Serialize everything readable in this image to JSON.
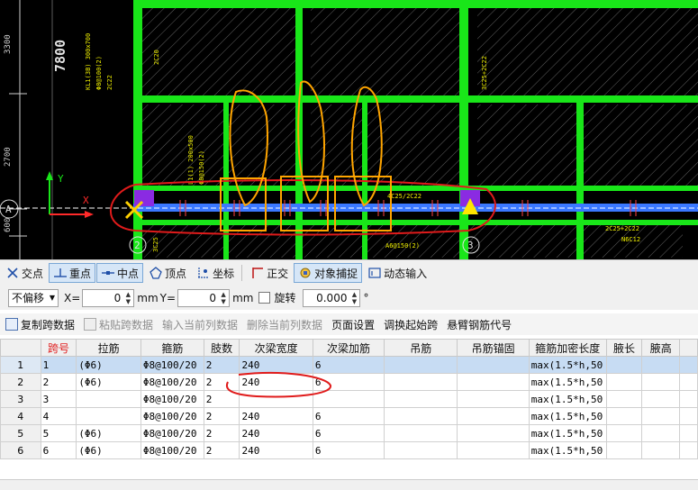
{
  "cad": {
    "dims": [
      "3300",
      "2700",
      "600"
    ],
    "big_label": "7800",
    "axis_letter": "A",
    "axis_numbers": [
      "2",
      "3"
    ],
    "y_axis": "Y",
    "x_axis": "X",
    "beam_texts": [
      "KL1(3B) 300x700",
      "Φ8@100(2)",
      "2C22",
      "3C25+2C22",
      "L1(1) 200x500",
      "Φ8@150(2)",
      "4C25/2C22",
      "A6@150(2)",
      "2C25+2C22",
      "N6C12",
      "2C20",
      "3C25"
    ]
  },
  "snapbar": {
    "items": [
      {
        "label": "交点",
        "icon": "cross-snap-icon",
        "active": false
      },
      {
        "label": "重点",
        "icon": "coincide-snap-icon",
        "active": true
      },
      {
        "label": "中点",
        "icon": "midpoint-snap-icon",
        "active": true
      },
      {
        "label": "顶点",
        "icon": "vertex-snap-icon",
        "active": false
      },
      {
        "label": "坐标",
        "icon": "coordinate-snap-icon",
        "active": false
      },
      {
        "label": "正交",
        "icon": "orthogonal-icon",
        "active": false
      },
      {
        "label": "对象捕捉",
        "icon": "object-snap-icon",
        "active": true
      },
      {
        "label": "动态输入",
        "icon": "dynamic-input-icon",
        "active": false
      }
    ]
  },
  "offsetbar": {
    "mode": "不偏移",
    "x_label": "X=",
    "x_value": "0",
    "x_unit": "mm",
    "y_label": "Y=",
    "y_value": "0",
    "y_unit": "mm",
    "rotate_label": "旋转",
    "rotate_value": "0.000",
    "degree": "°"
  },
  "gridtools": {
    "items": [
      {
        "label": "复制跨数据",
        "disabled": false
      },
      {
        "label": "粘贴跨数据",
        "disabled": true
      },
      {
        "label": "输入当前列数据",
        "disabled": true
      },
      {
        "label": "删除当前列数据",
        "disabled": true
      },
      {
        "label": "页面设置",
        "disabled": false
      },
      {
        "label": "调换起始跨",
        "disabled": false
      },
      {
        "label": "悬臂钢筋代号",
        "disabled": false
      }
    ]
  },
  "table": {
    "headers": {
      "span": "跨号",
      "tie": "拉筋",
      "stirrup": "箍筋",
      "legs": "肢数",
      "sec_width": "次梁宽度",
      "sec_add": "次梁加筋",
      "hanger": "吊筋",
      "hanger_anchor": "吊筋锚固",
      "dense_len": "箍筋加密长度",
      "haunch_len": "腋长",
      "haunch_h": "腋高"
    },
    "rows": [
      {
        "n": "1",
        "span": "1",
        "tie": "(Φ6)",
        "stirrup": "Φ8@100/20",
        "legs": "2",
        "sec_width": "240",
        "sec_add": "6",
        "dense_len": "max(1.5*h,50"
      },
      {
        "n": "2",
        "span": "2",
        "tie": "(Φ6)",
        "stirrup": "Φ8@100/20",
        "legs": "2",
        "sec_width": "240",
        "sec_add": "6",
        "dense_len": "max(1.5*h,50"
      },
      {
        "n": "3",
        "span": "3",
        "tie": "",
        "stirrup": "Φ8@100/20",
        "legs": "2",
        "sec_width": "",
        "sec_add": "",
        "dense_len": "max(1.5*h,50"
      },
      {
        "n": "4",
        "span": "4",
        "tie": "",
        "stirrup": "Φ8@100/20",
        "legs": "2",
        "sec_width": "240",
        "sec_add": "6",
        "dense_len": "max(1.5*h,50"
      },
      {
        "n": "5",
        "span": "5",
        "tie": "(Φ6)",
        "stirrup": "Φ8@100/20",
        "legs": "2",
        "sec_width": "240",
        "sec_add": "6",
        "dense_len": "max(1.5*h,50"
      },
      {
        "n": "6",
        "span": "6",
        "tie": "(Φ6)",
        "stirrup": "Φ8@100/20",
        "legs": "2",
        "sec_width": "240",
        "sec_add": "6",
        "dense_len": "max(1.5*h,50"
      }
    ]
  },
  "colors": {
    "beam_green": "#19e619",
    "selected_beam": "#3a78ff",
    "annotation_red": "#e01b1b",
    "annotation_orange": "#ffa500",
    "row_selected": "#c7dcf3"
  }
}
